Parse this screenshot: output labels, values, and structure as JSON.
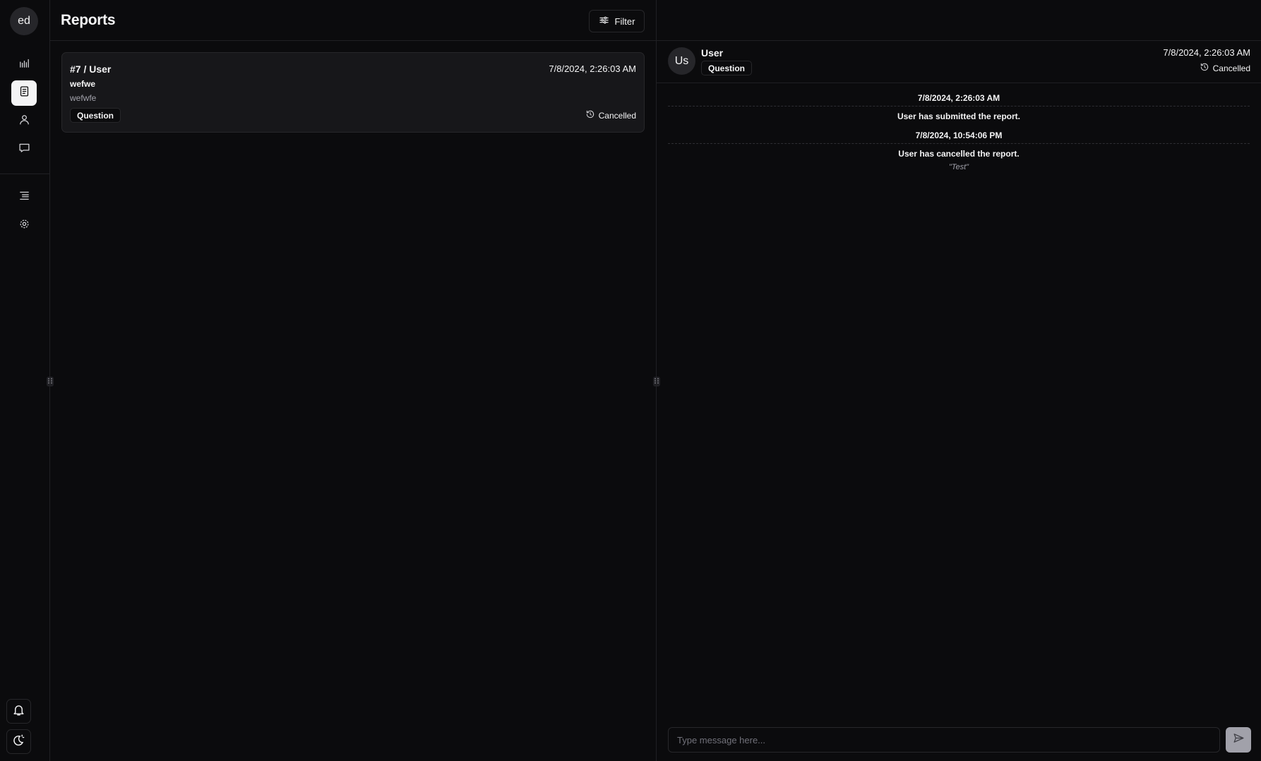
{
  "sidebar": {
    "avatar_initials": "ed",
    "nav_items": [
      {
        "name": "analytics",
        "icon": "bar-chart-icon",
        "active": false
      },
      {
        "name": "reports",
        "icon": "document-icon",
        "active": true
      },
      {
        "name": "users",
        "icon": "user-icon",
        "active": false
      },
      {
        "name": "messages",
        "icon": "message-icon",
        "active": false
      },
      {
        "name": "logs",
        "icon": "list-icon",
        "active": false
      },
      {
        "name": "settings",
        "icon": "gear-icon",
        "active": false
      }
    ],
    "bottom_items": [
      {
        "name": "notifications",
        "icon": "bell-icon"
      },
      {
        "name": "theme-toggle",
        "icon": "moon-sun-icon"
      }
    ]
  },
  "list": {
    "title": "Reports",
    "filter_label": "Filter",
    "reports": [
      {
        "id_label": "#7 / User",
        "date": "7/8/2024, 2:26:03 AM",
        "subject": "wefwe",
        "preview": "wefwfe",
        "category": "Question",
        "status": "Cancelled"
      }
    ]
  },
  "detail": {
    "avatar_initials": "Us",
    "user_name": "User",
    "category": "Question",
    "date": "7/8/2024, 2:26:03 AM",
    "status": "Cancelled",
    "timeline": [
      {
        "date": "7/8/2024, 2:26:03 AM",
        "text": "User has submitted the report.",
        "note": ""
      },
      {
        "date": "7/8/2024, 10:54:06 PM",
        "text": "User has cancelled the report.",
        "note": "\"Test\""
      }
    ],
    "composer_placeholder": "Type message here..."
  },
  "colors": {
    "background": "#0b0b0d",
    "card": "#17171a",
    "border": "#27272a",
    "text": "#f4f4f5",
    "muted": "#a1a1aa"
  }
}
